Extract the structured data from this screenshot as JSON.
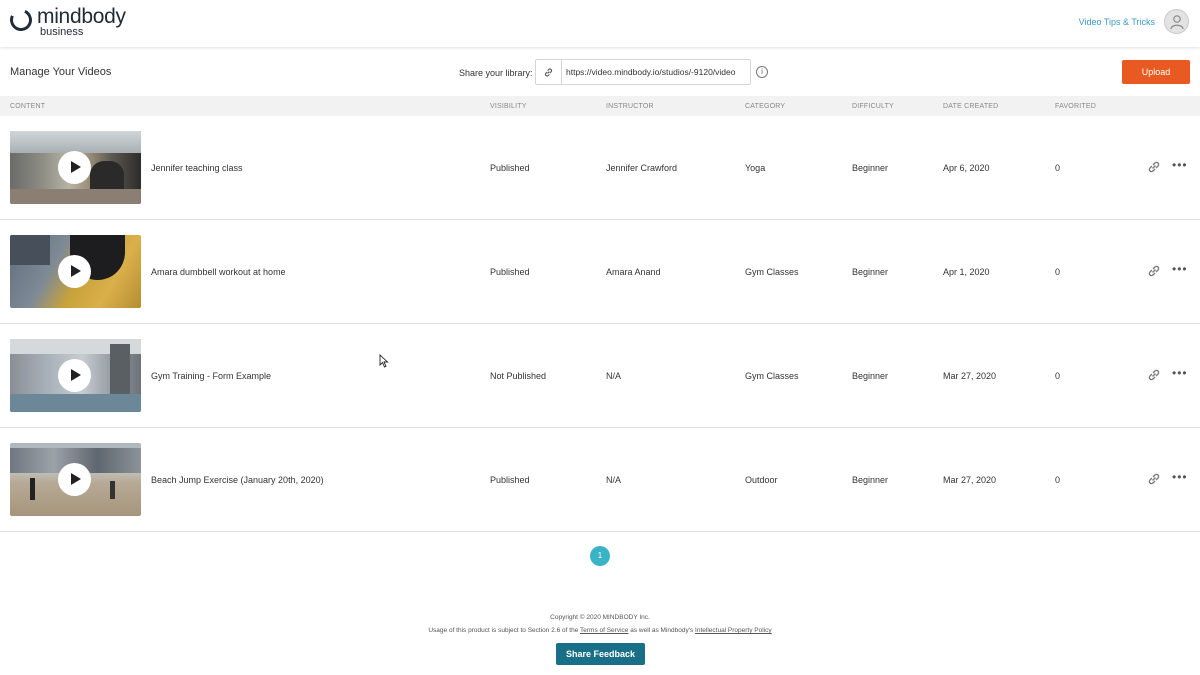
{
  "header": {
    "logo_main": "mindbody",
    "logo_sub": "business",
    "tips_link": "Video Tips & Tricks"
  },
  "toolbar": {
    "title": "Manage Your Videos",
    "share_label": "Share your library:",
    "share_url": "https://video.mindbody.io/studios/-9120/video",
    "info_glyph": "i",
    "upload_label": "Upload"
  },
  "table": {
    "headers": {
      "content": "CONTENT",
      "visibility": "VISIBILITY",
      "instructor": "INSTRUCTOR",
      "category": "CATEGORY",
      "difficulty": "DIFFICULTY",
      "date_created": "DATE CREATED",
      "favorited": "FAVORITED"
    },
    "rows": [
      {
        "title": "Jennifer teaching class",
        "visibility": "Published",
        "instructor": "Jennifer Crawford",
        "category": "Yoga",
        "difficulty": "Beginner",
        "date": "Apr 6, 2020",
        "favorited": "0"
      },
      {
        "title": "Amara dumbbell workout at home",
        "visibility": "Published",
        "instructor": "Amara Anand",
        "category": "Gym Classes",
        "difficulty": "Beginner",
        "date": "Apr 1, 2020",
        "favorited": "0"
      },
      {
        "title": "Gym Training - Form Example",
        "visibility": "Not Published",
        "instructor": "N/A",
        "category": "Gym Classes",
        "difficulty": "Beginner",
        "date": "Mar 27, 2020",
        "favorited": "0"
      },
      {
        "title": "Beach Jump Exercise (January 20th, 2020)",
        "visibility": "Published",
        "instructor": "N/A",
        "category": "Outdoor",
        "difficulty": "Beginner",
        "date": "Mar 27, 2020",
        "favorited": "0"
      }
    ],
    "more_glyph": "•••"
  },
  "pagination": {
    "current": "1"
  },
  "footer": {
    "copyright": "Copyright © 2020 MINDBODY Inc.",
    "usage_prefix": "Usage of this product is subject to Section 2.6 of the ",
    "terms_link": "Terms of Service",
    "usage_middle": " as well as Mindbody's ",
    "ip_link": "Intellectual Property Policy",
    "feedback_label": "Share Feedback"
  },
  "colors": {
    "accent_orange": "#e85a21",
    "accent_teal": "#1a6f88",
    "page_dot": "#3bb3c7",
    "link_blue": "#3a9bc8"
  }
}
